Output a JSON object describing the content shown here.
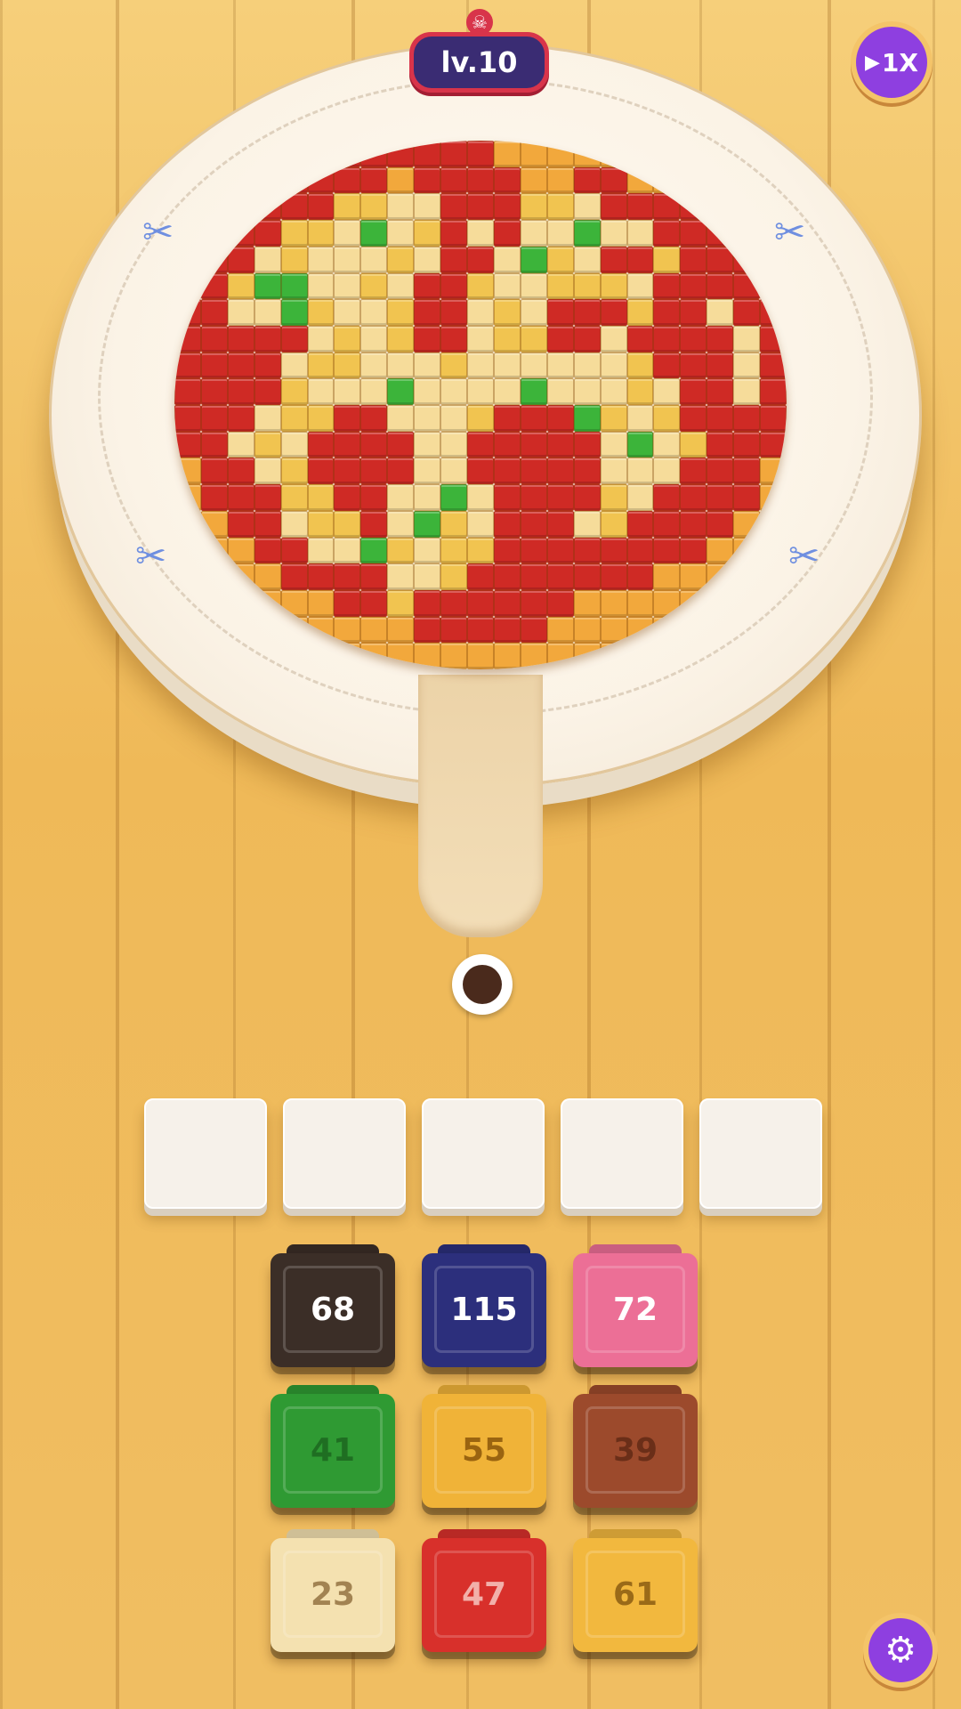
{
  "hud": {
    "level_label": "lv.10",
    "speed_label": "1X"
  },
  "icons": {
    "skull": "skull-icon",
    "play": "play-icon",
    "settings": "gear-icon"
  },
  "slots": [
    {
      "filled": false
    },
    {
      "filled": false
    },
    {
      "filled": false
    },
    {
      "filled": false
    },
    {
      "filled": false
    }
  ],
  "blocks": [
    {
      "count": "68",
      "color": "#3b2e27",
      "text_color": "#ffffff"
    },
    {
      "count": "115",
      "color": "#2c2f7c",
      "text_color": "#ffffff"
    },
    {
      "count": "72",
      "color": "#ec6f96",
      "text_color": "#ffffff"
    },
    {
      "count": "41",
      "color": "#2f9a33",
      "text_color": "#1f6e22"
    },
    {
      "count": "55",
      "color": "#f0b338",
      "text_color": "#9a6410"
    },
    {
      "count": "39",
      "color": "#9c4a2c",
      "text_color": "#6a2e18"
    },
    {
      "count": "23",
      "color": "#f4e1b0",
      "text_color": "#a28352"
    },
    {
      "count": "47",
      "color": "#d8302b",
      "text_color": "#f2b0aa"
    },
    {
      "count": "61",
      "color": "#f2b83e",
      "text_color": "#9a6a18"
    }
  ],
  "pizza_palette": {
    "O": "#f2a83c",
    "D": "#e8962e",
    "R": "#cf2a25",
    "Y": "#f1c450",
    "C": "#f6dc9a",
    "G": "#3cb43a"
  },
  "pizza_rows": [
    "OOOOOORRRRRROOOOOOOOOOO",
    "OOOORRRRORRRROORROOOOOO",
    "OOORRRYYCCRRRYYCRRRRROO",
    "OORRYYCGCYRCRCCGCCRRRRO",
    "ORRCYCCCYCRRCGYCRRYRRRO",
    "RRYGGCCYCRRYCCYYYCRRRRR",
    "RRCCGYCCYRRCYCRRRYRRCRR",
    "RRRRRCYCYRRCYYRRCRRRRCR",
    "RRRRCYYCCCYCCCCCCYRRRCR",
    "RRRRYCCCGCCCCGCCCYCRRCR",
    "RRRCYYRRCCCYRRRGYCYRRRR",
    "RRCYCRRRRCCRRRRRCGCYRRR",
    "ORRCYRRRRCCRRRRRCCCRRRO",
    "ORRRYYRRCCGCRRRRYCRRRRO",
    "OORRCYYRCGYCRRRCYRRRROO",
    "OOORRCCGYCYYRRRRRRRROOO",
    "OOOORRRRCCYRRRRRRROOOOO",
    "OOOOOORRYRRRRRROOOOOOOO",
    "OOOOOOOOORRRRROOOOOOOOO",
    "OOOOOOOOOOOOOOOOOOOOOOO"
  ]
}
